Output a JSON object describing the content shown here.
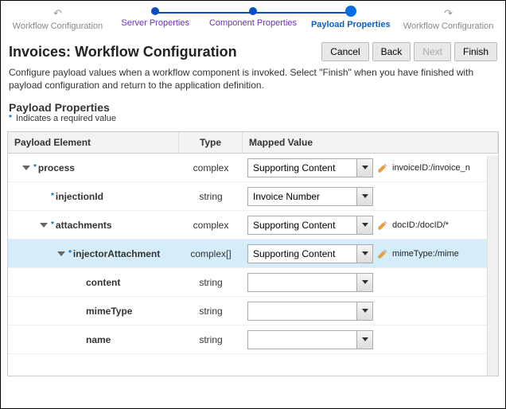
{
  "stepper": {
    "prev_nav": "Workflow Configuration",
    "steps": [
      "Server Properties",
      "Component Properties",
      "Payload Properties"
    ],
    "next_nav": "Workflow Configuration",
    "active_index": 2
  },
  "header": {
    "title": "Invoices: Workflow Configuration",
    "buttons": {
      "cancel": "Cancel",
      "back": "Back",
      "next": "Next",
      "finish": "Finish"
    }
  },
  "description": "Configure payload values when a workflow component is invoked. Select \"Finish\" when you have finished with payload configuration and return to the application definition.",
  "section": {
    "title": "Payload Properties",
    "required_note": "Indicates a required value"
  },
  "table": {
    "headers": {
      "element": "Payload Element",
      "type": "Type",
      "mapped": "Mapped Value"
    },
    "rows": [
      {
        "indent": 0,
        "expand": true,
        "required": true,
        "name": "process",
        "type": "complex",
        "mapped": "Supporting Content",
        "edit": true,
        "extra": "invoiceID:/invoice_n",
        "selected": false
      },
      {
        "indent": 1,
        "expand": false,
        "required": true,
        "name": "injectionId",
        "type": "string",
        "mapped": "Invoice Number",
        "edit": false,
        "extra": "",
        "selected": false
      },
      {
        "indent": 1,
        "expand": true,
        "required": true,
        "name": "attachments",
        "type": "complex",
        "mapped": "Supporting Content",
        "edit": true,
        "extra": "docID:/docID/*",
        "selected": false
      },
      {
        "indent": 2,
        "expand": true,
        "required": true,
        "name": "injectorAttachment",
        "type": "complex[]",
        "mapped": "Supporting Content",
        "edit": true,
        "extra": "mimeType:/mime",
        "selected": true
      },
      {
        "indent": 3,
        "expand": false,
        "required": false,
        "name": "content",
        "type": "string",
        "mapped": "",
        "edit": false,
        "extra": "",
        "selected": false
      },
      {
        "indent": 3,
        "expand": false,
        "required": false,
        "name": "mimeType",
        "type": "string",
        "mapped": "",
        "edit": false,
        "extra": "",
        "selected": false
      },
      {
        "indent": 3,
        "expand": false,
        "required": false,
        "name": "name",
        "type": "string",
        "mapped": "",
        "edit": false,
        "extra": "",
        "selected": false
      }
    ]
  }
}
